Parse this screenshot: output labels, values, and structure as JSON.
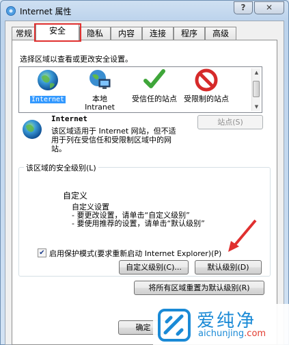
{
  "window": {
    "title": "Internet 属性",
    "help_glyph": "?",
    "close_glyph": "✕"
  },
  "tabs": [
    {
      "label": "常规",
      "active": false
    },
    {
      "label": "安全",
      "active": true
    },
    {
      "label": "隐私",
      "active": false
    },
    {
      "label": "内容",
      "active": false
    },
    {
      "label": "连接",
      "active": false
    },
    {
      "label": "程序",
      "active": false
    },
    {
      "label": "高级",
      "active": false
    }
  ],
  "security": {
    "zone_prompt": "选择区域以查看或更改安全设置。",
    "zones": [
      {
        "label": "Internet",
        "icon": "globe-icon",
        "selected": true
      },
      {
        "label": "本地 Intranet",
        "icon": "intranet-icon",
        "selected": false
      },
      {
        "label": "受信任的站点",
        "icon": "checkmark-icon",
        "selected": false
      },
      {
        "label": "受限制的站点",
        "icon": "no-entry-icon",
        "selected": false
      }
    ],
    "zone_title": "Internet",
    "zone_description": "该区域适用于 Internet 网站，但不适用于列在受信任和受限制区域中的网站。",
    "sites_button": "站点(S)",
    "level_group_title": "该区域的安全级别(L)",
    "level_name": "自定义",
    "level_desc_1": "自定义设置",
    "level_desc_2": "- 要更改设置，请单击“自定义级别”",
    "level_desc_3": "- 要使用推荐的设置，请单击“默认级别”",
    "protected_mode_label": "启用保护模式(要求重新启动 Internet Explorer)(P)",
    "protected_mode_checked": true,
    "custom_level_button": "自定义级别(C)...",
    "default_level_button": "默认级别(D)",
    "reset_all_button": "将所有区域重置为默认级别(R)"
  },
  "footer": {
    "ok_button": "确定"
  },
  "watermark": {
    "name": "爱纯净",
    "url_prefix": "aichunjing",
    "url_suffix": ".com"
  },
  "colors": {
    "highlight_red": "#e0302f",
    "selection_blue": "#3399ff",
    "watermark_blue": "#1a8ad6"
  }
}
